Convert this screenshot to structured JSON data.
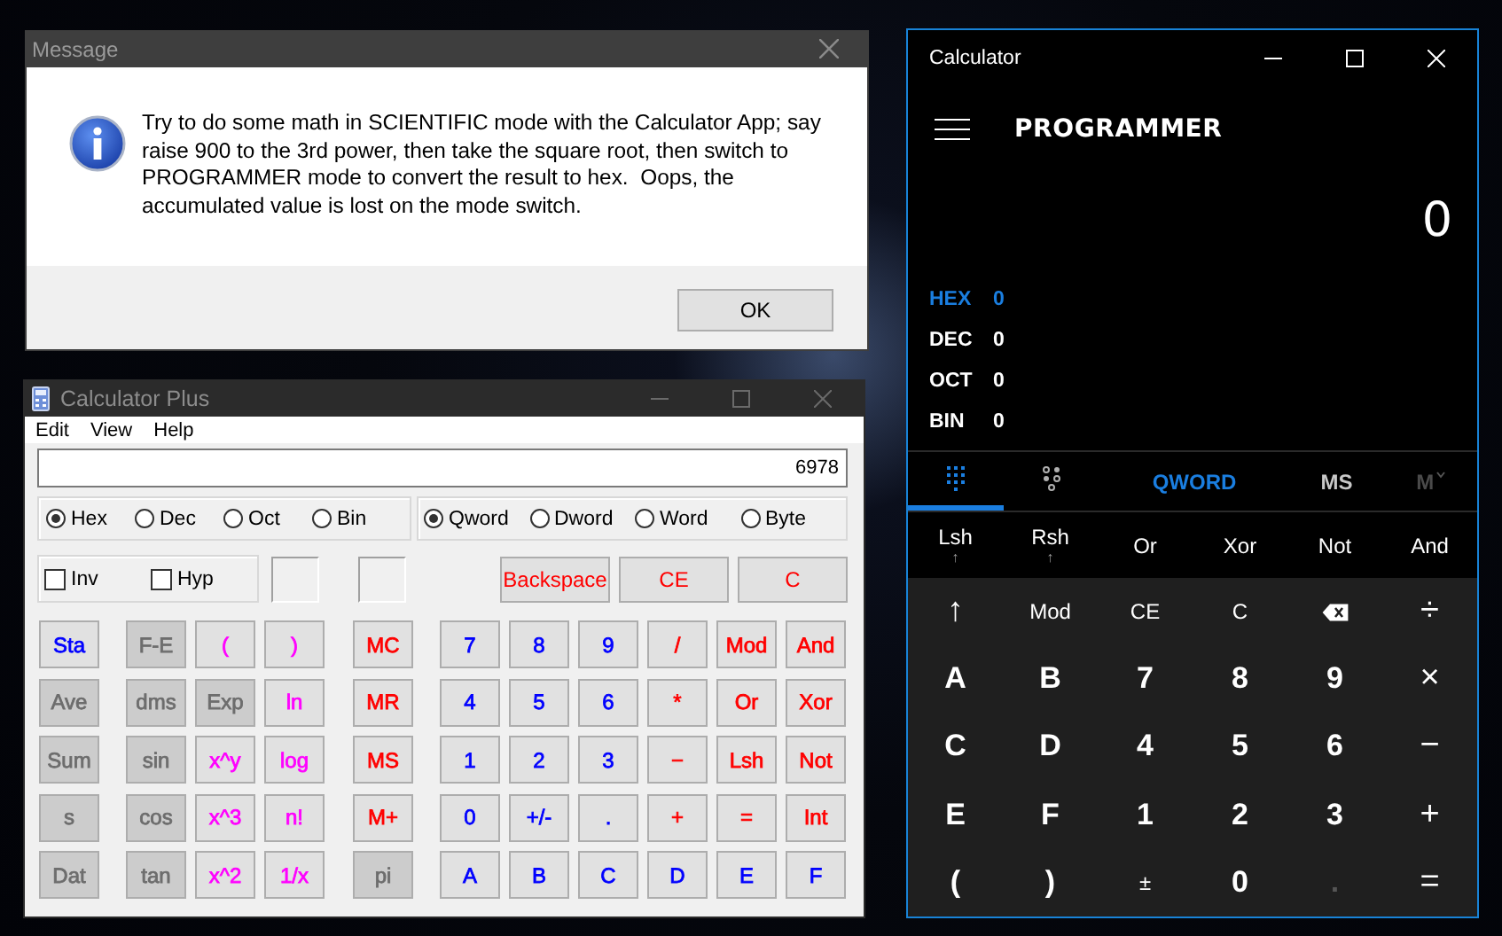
{
  "message_dialog": {
    "title": "Message",
    "text": "Try to do some math in SCIENTIFIC mode with the Calculator App; say raise 900 to the 3rd power, then take the square root, then switch to PROGRAMMER mode to convert the result to hex.  Oops, the accumulated value is lost on the mode switch.",
    "buttons": [
      {
        "label": "OK"
      }
    ]
  },
  "calculator_plus": {
    "title": "Calculator Plus",
    "menu": [
      "Edit",
      "View",
      "Help"
    ],
    "display": "6978",
    "number_base": [
      {
        "label": "Hex",
        "selected": true
      },
      {
        "label": "Dec",
        "selected": false
      },
      {
        "label": "Oct",
        "selected": false
      },
      {
        "label": "Bin",
        "selected": false
      }
    ],
    "word_size": [
      {
        "label": "Qword",
        "selected": true
      },
      {
        "label": "Dword",
        "selected": false
      },
      {
        "label": "Word",
        "selected": false
      },
      {
        "label": "Byte",
        "selected": false
      }
    ],
    "checkboxes": [
      {
        "label": "Inv",
        "checked": false
      },
      {
        "label": "Hyp",
        "checked": false
      }
    ],
    "edit_buttons": [
      {
        "label": "Backspace",
        "color": "#ff0000"
      },
      {
        "label": "CE",
        "color": "#ff0000"
      },
      {
        "label": "C",
        "color": "#ff0000"
      }
    ],
    "keys": [
      [
        {
          "label": "Sta",
          "color": "#0000ff",
          "disabled": false
        },
        {
          "label": "F-E",
          "color": "#6d6d6d",
          "disabled": true
        },
        {
          "label": "(",
          "color": "#ff00ff",
          "disabled": false
        },
        {
          "label": ")",
          "color": "#ff00ff",
          "disabled": false
        },
        {
          "label": "MC",
          "color": "#ff0000",
          "disabled": false
        },
        {
          "label": "7",
          "color": "#0000ff",
          "disabled": false
        },
        {
          "label": "8",
          "color": "#0000ff",
          "disabled": false
        },
        {
          "label": "9",
          "color": "#0000ff",
          "disabled": false
        },
        {
          "label": "/",
          "color": "#ff0000",
          "disabled": false
        },
        {
          "label": "Mod",
          "color": "#ff0000",
          "disabled": false
        },
        {
          "label": "And",
          "color": "#ff0000",
          "disabled": false
        }
      ],
      [
        {
          "label": "Ave",
          "color": "#6d6d6d",
          "disabled": true
        },
        {
          "label": "dms",
          "color": "#6d6d6d",
          "disabled": true
        },
        {
          "label": "Exp",
          "color": "#6d6d6d",
          "disabled": true
        },
        {
          "label": "ln",
          "color": "#ff00ff",
          "disabled": false
        },
        {
          "label": "MR",
          "color": "#ff0000",
          "disabled": false
        },
        {
          "label": "4",
          "color": "#0000ff",
          "disabled": false
        },
        {
          "label": "5",
          "color": "#0000ff",
          "disabled": false
        },
        {
          "label": "6",
          "color": "#0000ff",
          "disabled": false
        },
        {
          "label": "*",
          "color": "#ff0000",
          "disabled": false
        },
        {
          "label": "Or",
          "color": "#ff0000",
          "disabled": false
        },
        {
          "label": "Xor",
          "color": "#ff0000",
          "disabled": false
        }
      ],
      [
        {
          "label": "Sum",
          "color": "#6d6d6d",
          "disabled": true
        },
        {
          "label": "sin",
          "color": "#6d6d6d",
          "disabled": true
        },
        {
          "label": "x^y",
          "color": "#ff00ff",
          "disabled": false
        },
        {
          "label": "log",
          "color": "#ff00ff",
          "disabled": false
        },
        {
          "label": "MS",
          "color": "#ff0000",
          "disabled": false
        },
        {
          "label": "1",
          "color": "#0000ff",
          "disabled": false
        },
        {
          "label": "2",
          "color": "#0000ff",
          "disabled": false
        },
        {
          "label": "3",
          "color": "#0000ff",
          "disabled": false
        },
        {
          "label": "−",
          "color": "#ff0000",
          "disabled": false
        },
        {
          "label": "Lsh",
          "color": "#ff0000",
          "disabled": false
        },
        {
          "label": "Not",
          "color": "#ff0000",
          "disabled": false
        }
      ],
      [
        {
          "label": "s",
          "color": "#6d6d6d",
          "disabled": true
        },
        {
          "label": "cos",
          "color": "#6d6d6d",
          "disabled": true
        },
        {
          "label": "x^3",
          "color": "#ff00ff",
          "disabled": false
        },
        {
          "label": "n!",
          "color": "#ff00ff",
          "disabled": false
        },
        {
          "label": "M+",
          "color": "#ff0000",
          "disabled": false
        },
        {
          "label": "0",
          "color": "#0000ff",
          "disabled": false
        },
        {
          "label": "+/-",
          "color": "#0000ff",
          "disabled": false
        },
        {
          "label": ".",
          "color": "#0000ff",
          "disabled": false
        },
        {
          "label": "+",
          "color": "#ff0000",
          "disabled": false
        },
        {
          "label": "=",
          "color": "#ff0000",
          "disabled": false
        },
        {
          "label": "Int",
          "color": "#ff0000",
          "disabled": false
        }
      ],
      [
        {
          "label": "Dat",
          "color": "#6d6d6d",
          "disabled": true
        },
        {
          "label": "tan",
          "color": "#6d6d6d",
          "disabled": true
        },
        {
          "label": "x^2",
          "color": "#ff00ff",
          "disabled": false
        },
        {
          "label": "1/x",
          "color": "#ff00ff",
          "disabled": false
        },
        {
          "label": "pi",
          "color": "#6d6d6d",
          "disabled": true
        },
        {
          "label": "A",
          "color": "#0000ff",
          "disabled": false
        },
        {
          "label": "B",
          "color": "#0000ff",
          "disabled": false
        },
        {
          "label": "C",
          "color": "#0000ff",
          "disabled": false
        },
        {
          "label": "D",
          "color": "#0000ff",
          "disabled": false
        },
        {
          "label": "E",
          "color": "#0000ff",
          "disabled": false
        },
        {
          "label": "F",
          "color": "#0000ff",
          "disabled": false
        }
      ]
    ]
  },
  "windows_calculator": {
    "title": "Calculator",
    "mode": "PROGRAMMER",
    "display": "0",
    "radix": [
      {
        "label": "HEX",
        "value": "0",
        "selected": true
      },
      {
        "label": "DEC",
        "value": "0",
        "selected": false
      },
      {
        "label": "OCT",
        "value": "0",
        "selected": false
      },
      {
        "label": "BIN",
        "value": "0",
        "selected": false
      }
    ],
    "view_tabs": [
      {
        "kind": "keypad",
        "selected": true
      },
      {
        "kind": "bits",
        "selected": false
      }
    ],
    "word_size": "QWORD",
    "memory_buttons": [
      {
        "label": "MS",
        "kind": "store",
        "disabled": false
      },
      {
        "label": "M",
        "kind": "list",
        "disabled": true
      }
    ],
    "bitwise": [
      {
        "label": "Lsh",
        "sub": "↑"
      },
      {
        "label": "Rsh",
        "sub": "↑"
      },
      {
        "label": "Or"
      },
      {
        "label": "Xor"
      },
      {
        "label": "Not"
      },
      {
        "label": "And"
      }
    ],
    "keys": [
      {
        "label": "↑",
        "kind": "operator",
        "disabled": false
      },
      {
        "label": "Mod",
        "kind": "function",
        "disabled": false
      },
      {
        "label": "CE",
        "kind": "function",
        "disabled": false
      },
      {
        "label": "C",
        "kind": "function",
        "disabled": false
      },
      {
        "kind": "backspace",
        "disabled": false
      },
      {
        "label": "÷",
        "kind": "operator",
        "disabled": false
      },
      {
        "label": "A",
        "kind": "digit",
        "disabled": false
      },
      {
        "label": "B",
        "kind": "digit",
        "disabled": false
      },
      {
        "label": "7",
        "kind": "digit",
        "disabled": false
      },
      {
        "label": "8",
        "kind": "digit",
        "disabled": false
      },
      {
        "label": "9",
        "kind": "digit",
        "disabled": false
      },
      {
        "label": "×",
        "kind": "operator",
        "disabled": false
      },
      {
        "label": "C",
        "kind": "digit",
        "disabled": false
      },
      {
        "label": "D",
        "kind": "digit",
        "disabled": false
      },
      {
        "label": "4",
        "kind": "digit",
        "disabled": false
      },
      {
        "label": "5",
        "kind": "digit",
        "disabled": false
      },
      {
        "label": "6",
        "kind": "digit",
        "disabled": false
      },
      {
        "label": "−",
        "kind": "operator",
        "disabled": false
      },
      {
        "label": "E",
        "kind": "digit",
        "disabled": false
      },
      {
        "label": "F",
        "kind": "digit",
        "disabled": false
      },
      {
        "label": "1",
        "kind": "digit",
        "disabled": false
      },
      {
        "label": "2",
        "kind": "digit",
        "disabled": false
      },
      {
        "label": "3",
        "kind": "digit",
        "disabled": false
      },
      {
        "label": "+",
        "kind": "operator",
        "disabled": false
      },
      {
        "label": "(",
        "kind": "digit",
        "disabled": false
      },
      {
        "label": ")",
        "kind": "digit",
        "disabled": false
      },
      {
        "label": "±",
        "kind": "function",
        "disabled": false
      },
      {
        "label": "0",
        "kind": "digit",
        "disabled": false
      },
      {
        "label": ".",
        "kind": "digit",
        "disabled": true
      },
      {
        "label": "=",
        "kind": "operator",
        "disabled": false
      }
    ]
  }
}
